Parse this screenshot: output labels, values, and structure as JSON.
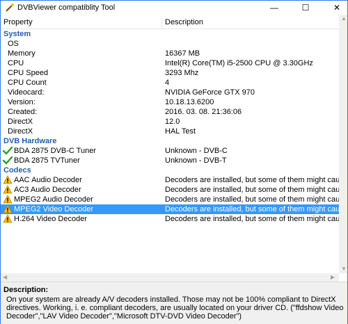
{
  "window": {
    "title": "DVBViewer compatiblity Tool",
    "controls": {
      "minimize": "—",
      "maximize": "☐",
      "close": "✕"
    }
  },
  "columns": {
    "property": "Property",
    "description": "Description"
  },
  "rows": [
    {
      "type": "group",
      "property": "System",
      "description": ""
    },
    {
      "type": "item",
      "property": "OS",
      "description": ""
    },
    {
      "type": "item",
      "property": "Memory",
      "description": "16367 MB"
    },
    {
      "type": "item",
      "property": "CPU",
      "description": "Intel(R) Core(TM) i5-2500 CPU @ 3.30GHz"
    },
    {
      "type": "item",
      "property": "CPU Speed",
      "description": "3293 Mhz"
    },
    {
      "type": "item",
      "property": "CPU Count",
      "description": "4"
    },
    {
      "type": "item",
      "property": "Videocard:",
      "description": "NVIDIA GeForce GTX 970"
    },
    {
      "type": "item",
      "property": "Version:",
      "description": "10.18.13.6200"
    },
    {
      "type": "item",
      "property": "Created:",
      "description": "2016. 03. 08. 21:36:06"
    },
    {
      "type": "item",
      "property": "DirectX",
      "description": "12.0"
    },
    {
      "type": "item",
      "property": "DirectX",
      "description": "HAL Test"
    },
    {
      "type": "group",
      "property": "DVB Hardware",
      "description": ""
    },
    {
      "type": "item",
      "icon": "check-icon",
      "property": "BDA 2875 DVB-C Tuner",
      "description": "Unknown - DVB-C"
    },
    {
      "type": "item",
      "icon": "check-icon",
      "property": "BDA 2875 TVTuner",
      "description": "Unknown - DVB-T"
    },
    {
      "type": "group",
      "property": "Codecs",
      "description": ""
    },
    {
      "type": "item",
      "icon": "warning-icon",
      "property": "AAC Audio Decoder",
      "description": "Decoders are installed, but some of them might cause problems."
    },
    {
      "type": "item",
      "icon": "warning-icon",
      "property": "AC3 Audio Decoder",
      "description": "Decoders are installed, but some of them might cause problems."
    },
    {
      "type": "item",
      "icon": "warning-icon",
      "property": "MPEG2 Audio Decoder",
      "description": "Decoders are installed, but some of them might cause problems."
    },
    {
      "type": "item",
      "icon": "warning-icon",
      "property": "MPEG2 Video Decoder",
      "description": "Decoders are installed, but some of them might cause problems.",
      "selected": true
    },
    {
      "type": "item",
      "icon": "warning-icon",
      "property": "H.264 Video Decoder",
      "description": "Decoders are installed, but some of them might cause problems."
    }
  ],
  "description_panel": {
    "title": "Description:",
    "text": "On your system are already A/V decoders installed. Those may not be 100% compliant to DirectX directives. Working, i. e. compliant decoders, are usually located on your driver CD. (\"ffdshow Video Decoder\",\"LAV Video Decoder\",\"Microsoft DTV-DVD Video Decoder\")"
  },
  "colors": {
    "accent": "#3399ff",
    "group_text": "#1f5fa8",
    "border": "#2b78e4"
  }
}
